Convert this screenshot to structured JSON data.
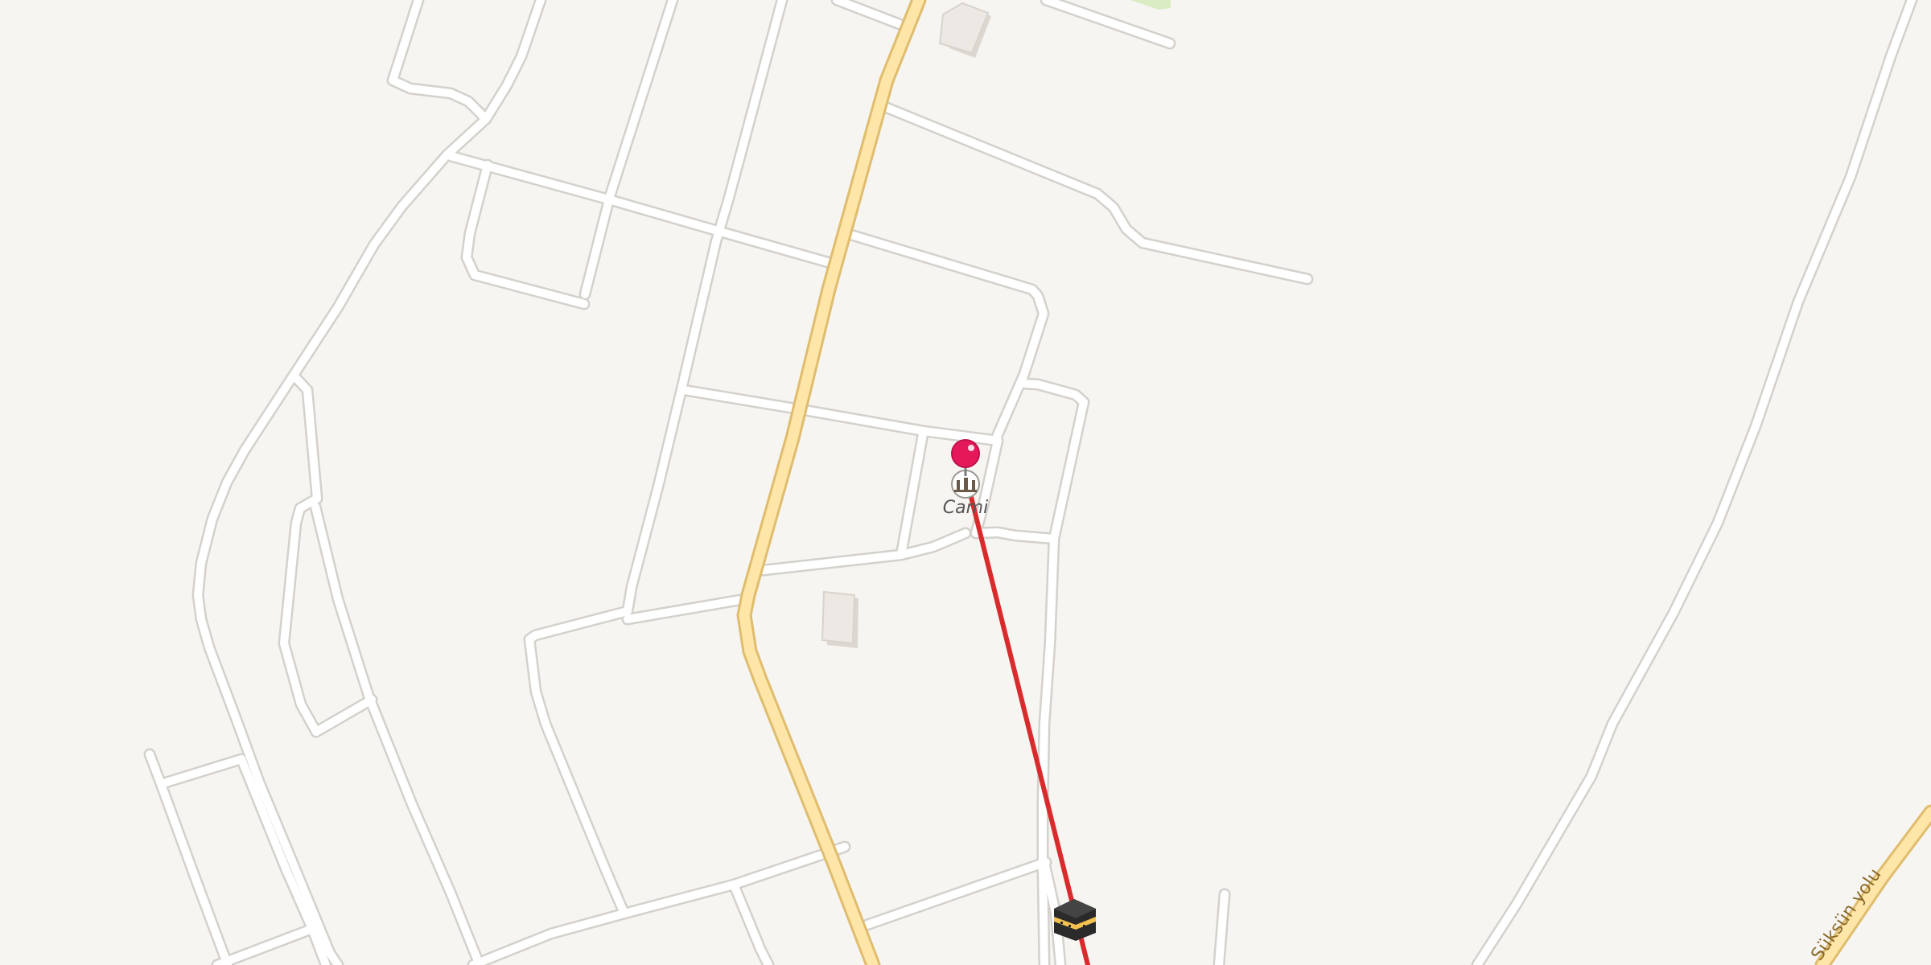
{
  "map": {
    "background_color": "#f7f5f2",
    "road_color": "#ffffff",
    "primary_road_color": "#fde6a8",
    "route_color": "#d92b2b",
    "park_color": "#d9ecc4"
  },
  "labels": {
    "poi_mosque": "Cami",
    "road_name": "Süksün yolu"
  },
  "markers": {
    "destination": {
      "icon": "pink-map-pin-icon",
      "color": "#e5185a"
    },
    "mosque": {
      "icon": "mosque-icon"
    },
    "kaaba": {
      "icon": "kaaba-icon"
    }
  }
}
